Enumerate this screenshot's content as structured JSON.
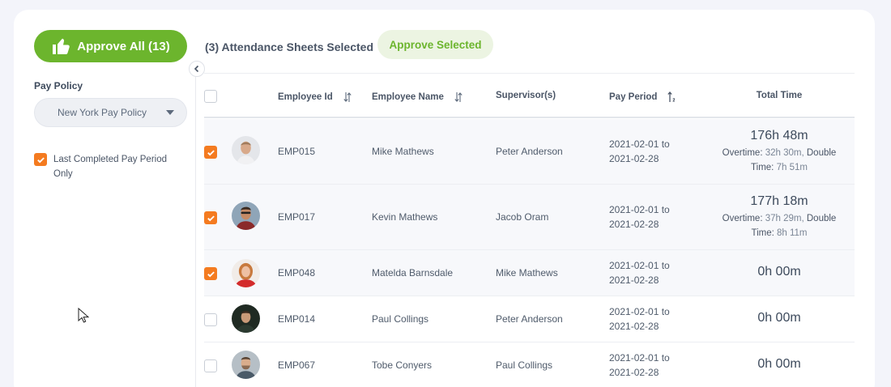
{
  "sidebar": {
    "approve_all_label": "Approve All (13)",
    "pay_policy_label": "Pay Policy",
    "pay_policy_value": "New York Pay Policy",
    "last_completed_label": "Last Completed Pay Period Only",
    "last_completed_checked": true
  },
  "toolbar": {
    "selected_text": "(3) Attendance Sheets Selected",
    "approve_selected_label": "Approve Selected"
  },
  "table": {
    "columns": [
      "Employee Id",
      "Employee Name",
      "Supervisor(s)",
      "Pay Period",
      "Total Time"
    ],
    "overtime_label": "Overtime:",
    "double_label": "Double",
    "time_label": "Time:",
    "rows": [
      {
        "checked": true,
        "id": "EMP015",
        "name": "Mike Mathews",
        "supervisor": "Peter Anderson",
        "period_start": "2021-02-01 to",
        "period_end": "2021-02-28",
        "total": "176h 48m",
        "overtime": "32h 30m,",
        "double_time": "7h 51m"
      },
      {
        "checked": true,
        "id": "EMP017",
        "name": "Kevin Mathews",
        "supervisor": "Jacob Oram",
        "period_start": "2021-02-01 to",
        "period_end": "2021-02-28",
        "total": "177h 18m",
        "overtime": "37h 29m,",
        "double_time": "8h 11m"
      },
      {
        "checked": true,
        "id": "EMP048",
        "name": "Matelda Barnsdale",
        "supervisor": "Mike Mathews",
        "period_start": "2021-02-01 to",
        "period_end": "2021-02-28",
        "total": "0h 00m"
      },
      {
        "checked": false,
        "id": "EMP014",
        "name": "Paul Collings",
        "supervisor": "Peter Anderson",
        "period_start": "2021-02-01 to",
        "period_end": "2021-02-28",
        "total": "0h 00m"
      },
      {
        "checked": false,
        "id": "EMP067",
        "name": "Tobe Conyers",
        "supervisor": "Paul Collings",
        "period_start": "2021-02-01 to",
        "period_end": "2021-02-28",
        "total": "0h 00m"
      }
    ]
  },
  "colors": {
    "accent_green": "#6cb52d",
    "check_orange": "#f47b20",
    "approve_selected_bg": "#ecf4e2"
  },
  "icons": [
    "thumbs-up-icon",
    "chevron-left-icon",
    "sort-icon",
    "sort-numeric-icon",
    "check-icon",
    "caret-down-icon",
    "mouse-cursor-icon"
  ]
}
